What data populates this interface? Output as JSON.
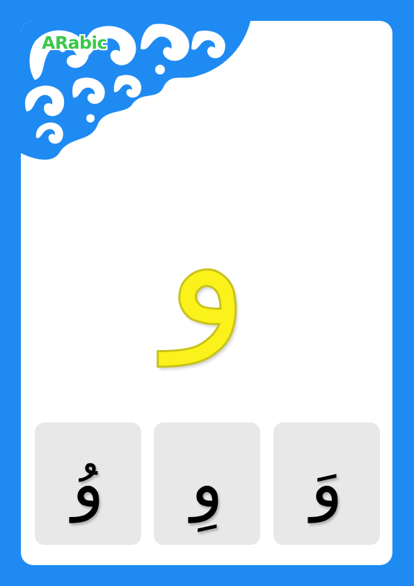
{
  "brand": {
    "label": "ARabic",
    "color": "#38c84a"
  },
  "colors": {
    "frame": "#1f8bf2",
    "card": "#ffffff",
    "letter": "#fbf11b",
    "tile": "#e8e8e8"
  },
  "letter": {
    "main": "و"
  },
  "tiles": [
    {
      "text": "وُ"
    },
    {
      "text": "وِ"
    },
    {
      "text": "وَ"
    }
  ],
  "icons": {
    "corner": "swirl-ornament-icon"
  }
}
